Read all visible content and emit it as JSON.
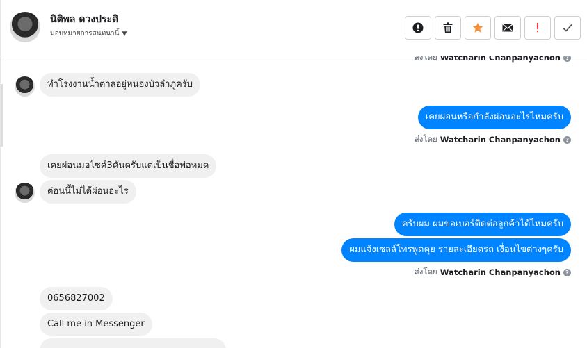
{
  "header": {
    "contact_name": "นิติพล ดวงประดิ",
    "assign_label": "มอบหมายการสนทนานี้",
    "toolbar": [
      {
        "name": "alert-circle-icon",
        "color": "#1c1e21"
      },
      {
        "name": "trash-icon",
        "color": "#1c1e21"
      },
      {
        "name": "star-icon",
        "color": "#f7923b"
      },
      {
        "name": "envelope-icon",
        "color": "#1c1e21"
      },
      {
        "name": "exclamation-icon",
        "color": "#fa383e"
      },
      {
        "name": "checkmark-icon",
        "color": "#444950"
      }
    ]
  },
  "conversation": {
    "sent_by_prefix": "ส่งโดย",
    "agent_name": "Watcharin Chanpanyachon",
    "messages": [
      {
        "text": "ทำโรงงานน้ำตาลอยู่หนองบัวลำภูครับ",
        "direction": "in"
      },
      {
        "text": "เคยผ่อนหรือกำลังผ่อนอะไรไหมครับ",
        "direction": "out"
      },
      {
        "text": "เคยผ่อนมอไซค์3คันครับแต่เป็นชื่อพ่อหมด",
        "direction": "in"
      },
      {
        "text": "ต่อนนี้ไม่ได้ผ่อนอะไร",
        "direction": "in"
      },
      {
        "text": "ครับผม ผมขอเบอร์ติดต่อลูกค้าได้ไหมครับ",
        "direction": "out"
      },
      {
        "text": "ผมแจ้งเซลล์โทรพูดคุย รายละเอียดรถ เงื่อนไขต่างๆครับ",
        "direction": "out"
      },
      {
        "text": "0656827002",
        "direction": "in"
      },
      {
        "text": "Call me in Messenger",
        "direction": "in"
      }
    ]
  },
  "colors": {
    "outgoing_bubble": "#0084ff",
    "incoming_bubble": "#f0f0f0"
  }
}
